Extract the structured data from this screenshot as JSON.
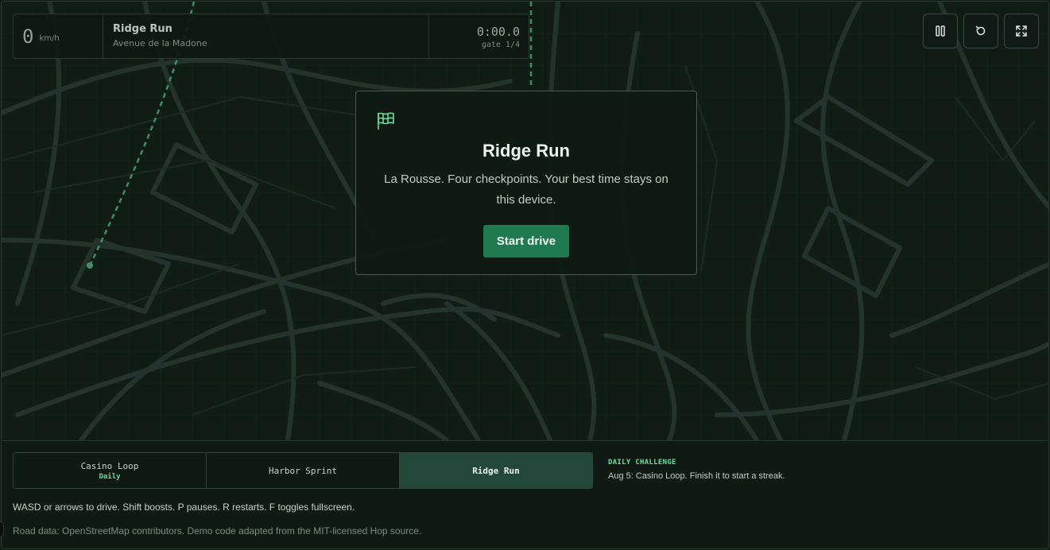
{
  "hud": {
    "speed": "0",
    "speed_unit": "km/h",
    "route_name": "Ridge Run",
    "street": "Avenue de la Madone",
    "time": "0:00.0",
    "gate": "gate 1/4"
  },
  "controls": {
    "pause_icon": "pause-icon",
    "restart_icon": "restart-icon",
    "fullscreen_icon": "fullscreen-icon"
  },
  "modal": {
    "icon": "flag-icon",
    "title": "Ridge Run",
    "description": "La Rousse. Four checkpoints. Your best time stays on this device.",
    "start_label": "Start drive"
  },
  "tabs": [
    {
      "label": "Casino Loop",
      "badge": "Daily",
      "active": false
    },
    {
      "label": "Harbor Sprint",
      "badge": "",
      "active": false
    },
    {
      "label": "Ridge Run",
      "badge": "",
      "active": true
    }
  ],
  "daily": {
    "label": "DAILY CHALLENGE",
    "text": "Aug 5: Casino Loop. Finish it to start a streak."
  },
  "help_text": "WASD or arrows to drive. Shift boosts. P pauses. R restarts. F toggles fullscreen.",
  "credits": "Road data: OpenStreetMap contributors. Demo code adapted from the MIT-licensed Hop source.",
  "colors": {
    "accent": "#6fdc9a",
    "button": "#1f7a4f",
    "background": "#101a15",
    "road": "#2b3b33"
  }
}
